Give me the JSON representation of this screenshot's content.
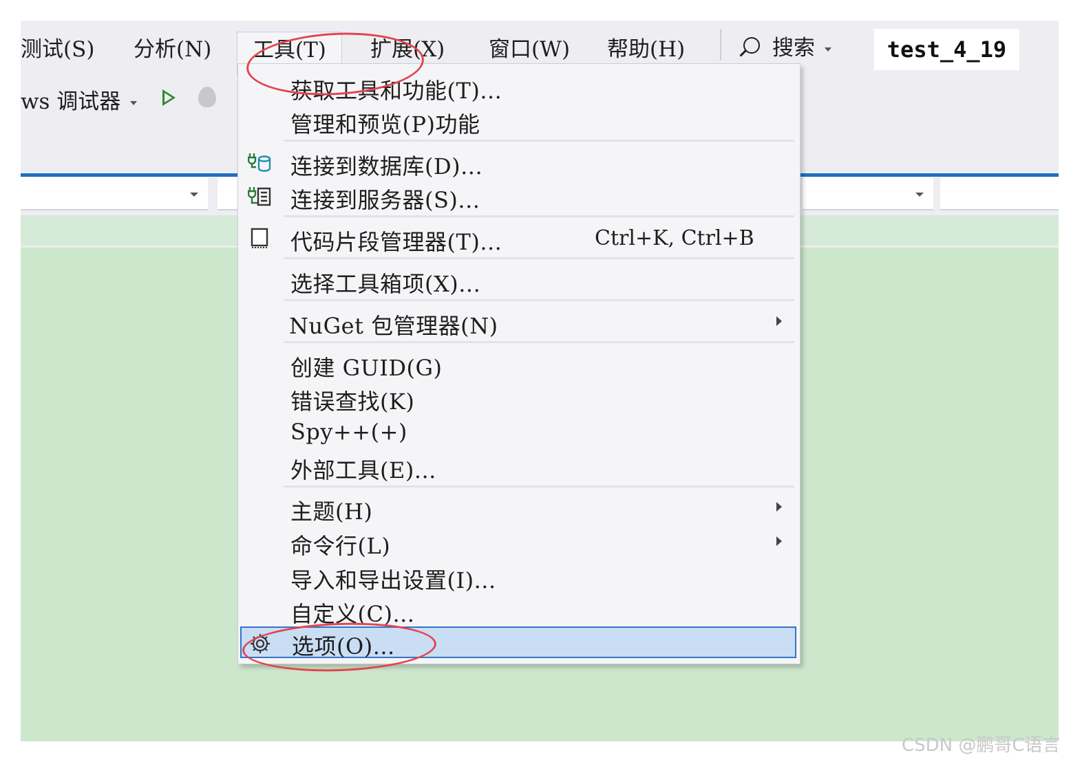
{
  "window": {
    "menubar": {
      "items": [
        {
          "label": "测试(S)"
        },
        {
          "label": "分析(N)"
        },
        {
          "label": "工具(T)"
        },
        {
          "label": "扩展(X)"
        },
        {
          "label": "窗口(W)"
        },
        {
          "label": "帮助(H)"
        }
      ],
      "search_label": "搜索",
      "project_name": "test_4_19"
    },
    "toolbar": {
      "debugger_label": "ws 调试器",
      "start_icon": "play-icon",
      "hot_reload_icon": "flame-icon"
    }
  },
  "tools_menu": {
    "items": [
      {
        "label": "获取工具和功能(T)..."
      },
      {
        "label": "管理和预览(P)功能"
      },
      {
        "label": "连接到数据库(D)...",
        "icon": "database-connect-icon"
      },
      {
        "label": "连接到服务器(S)...",
        "icon": "server-connect-icon"
      },
      {
        "label": "代码片段管理器(T)...",
        "shortcut": "Ctrl+K, Ctrl+B",
        "icon": "snippet-icon"
      },
      {
        "label": "选择工具箱项(X)..."
      },
      {
        "label": "NuGet 包管理器(N)",
        "submenu": true
      },
      {
        "label": "创建 GUID(G)"
      },
      {
        "label": "错误查找(K)"
      },
      {
        "label": "Spy++(+)"
      },
      {
        "label": "外部工具(E)..."
      },
      {
        "label": "主题(H)",
        "submenu": true
      },
      {
        "label": "命令行(L)",
        "submenu": true
      },
      {
        "label": "导入和导出设置(I)..."
      },
      {
        "label": "自定义(C)..."
      },
      {
        "label": "选项(O)...",
        "icon": "gear-icon",
        "highlighted": true
      }
    ]
  },
  "annotations": {
    "circle_color": "#e2454d",
    "circled_items": [
      "工具(T)",
      "选项(O)..."
    ]
  },
  "watermark": "CSDN @鹏哥C语言",
  "colors": {
    "selection_bg": "#c9def5",
    "selection_border": "#3373c4",
    "accent_blue": "#1f6fbf",
    "editor_green": "#cde7cd"
  }
}
